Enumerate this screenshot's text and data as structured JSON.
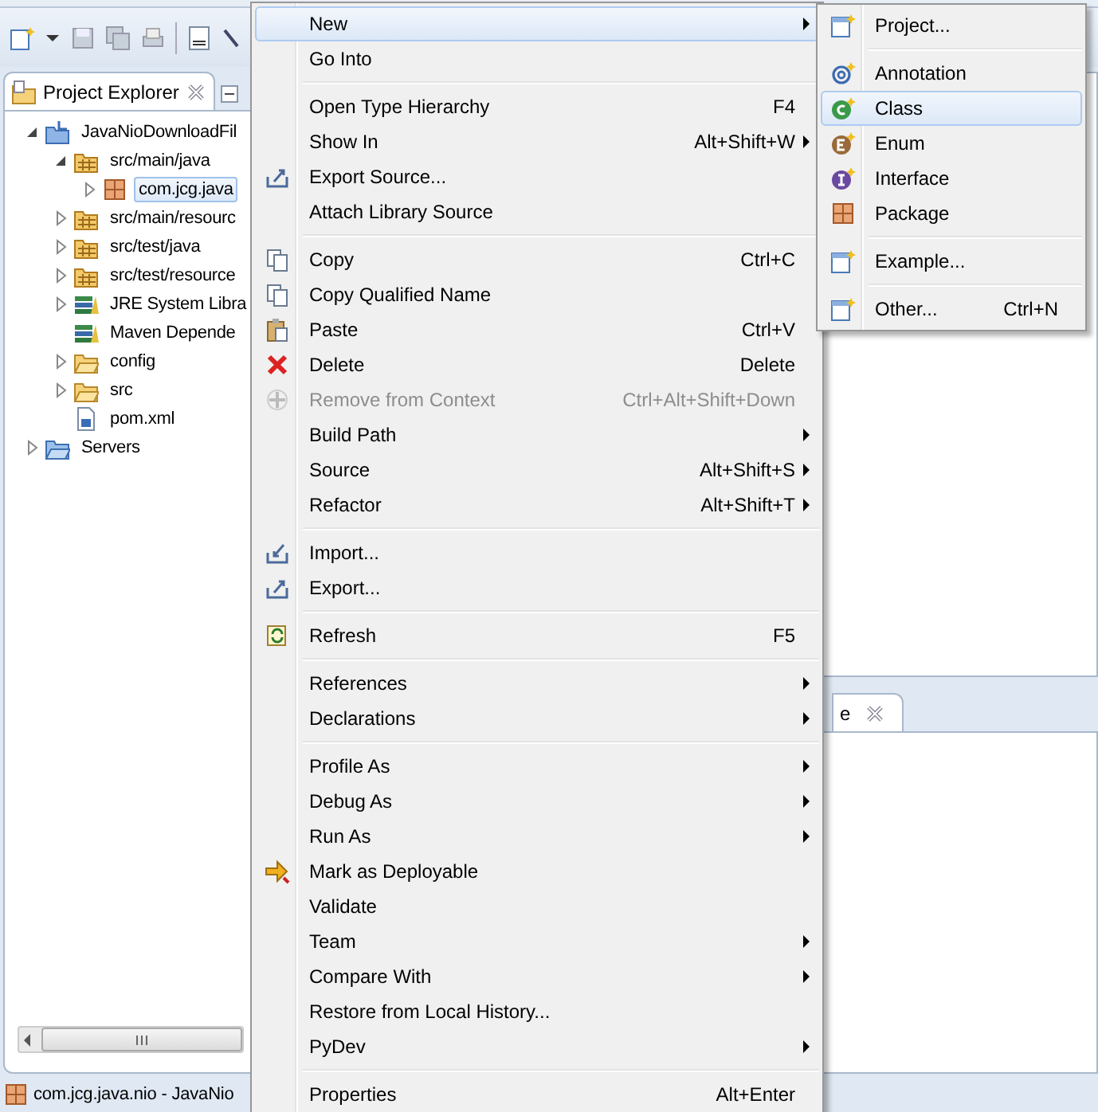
{
  "explorer": {
    "tab_title": "Project Explorer",
    "tree": [
      {
        "label": "JavaNioDownloadFil",
        "kind": "project",
        "expanded": true,
        "selected": false,
        "children": [
          {
            "label": "src/main/java",
            "kind": "source-folder",
            "expanded": true,
            "selected": false,
            "children": [
              {
                "label": "com.jcg.java",
                "kind": "package",
                "expanded": false,
                "selected": true
              }
            ]
          },
          {
            "label": "src/main/resourc",
            "kind": "source-folder",
            "expanded": false,
            "selected": false
          },
          {
            "label": "src/test/java",
            "kind": "source-folder",
            "expanded": false,
            "selected": false
          },
          {
            "label": "src/test/resource",
            "kind": "source-folder",
            "expanded": false,
            "selected": false
          },
          {
            "label": "JRE System Libra",
            "kind": "library",
            "expanded": false,
            "selected": false
          },
          {
            "label": "Maven Depende",
            "kind": "library",
            "selected": false
          },
          {
            "label": "config",
            "kind": "folder",
            "expanded": false,
            "selected": false
          },
          {
            "label": "src",
            "kind": "folder",
            "expanded": false,
            "selected": false
          },
          {
            "label": "pom.xml",
            "kind": "file",
            "selected": false
          }
        ]
      },
      {
        "label": "Servers",
        "kind": "server-folder",
        "expanded": false,
        "selected": false
      }
    ]
  },
  "lower_panel": {
    "tab_title": "e"
  },
  "status_bar": {
    "text": "com.jcg.java.nio - JavaNio"
  },
  "context_menu": {
    "items": [
      {
        "kind": "plain",
        "label": "New",
        "submenu": true,
        "selected": true,
        "disabled": false
      },
      {
        "kind": "plain",
        "label": "Go Into",
        "submenu": false,
        "selected": false,
        "disabled": false
      },
      {
        "kind": "separator"
      },
      {
        "kind": "plain",
        "label": "Open Type Hierarchy",
        "shortcut": "F4",
        "submenu": false,
        "selected": false,
        "disabled": false
      },
      {
        "kind": "plain",
        "label": "Show In",
        "shortcut": "Alt+Shift+W",
        "submenu": true,
        "selected": false,
        "disabled": false
      },
      {
        "kind": "export",
        "label": "Export Source...",
        "submenu": false,
        "selected": false,
        "disabled": false
      },
      {
        "kind": "plain",
        "label": "Attach Library Source",
        "submenu": false,
        "selected": false,
        "disabled": false
      },
      {
        "kind": "separator"
      },
      {
        "kind": "copy",
        "label": "Copy",
        "shortcut": "Ctrl+C",
        "submenu": false,
        "selected": false,
        "disabled": false
      },
      {
        "kind": "copy",
        "label": "Copy Qualified Name",
        "submenu": false,
        "selected": false,
        "disabled": false
      },
      {
        "kind": "paste",
        "label": "Paste",
        "shortcut": "Ctrl+V",
        "submenu": false,
        "selected": false,
        "disabled": false
      },
      {
        "kind": "delete",
        "label": "Delete",
        "shortcut": "Delete",
        "submenu": false,
        "selected": false,
        "disabled": false
      },
      {
        "kind": "remove",
        "label": "Remove from Context",
        "shortcut": "Ctrl+Alt+Shift+Down",
        "submenu": false,
        "selected": false,
        "disabled": true
      },
      {
        "kind": "plain",
        "label": "Build Path",
        "submenu": true,
        "selected": false,
        "disabled": false
      },
      {
        "kind": "plain",
        "label": "Source",
        "shortcut": "Alt+Shift+S",
        "submenu": true,
        "selected": false,
        "disabled": false
      },
      {
        "kind": "plain",
        "label": "Refactor",
        "shortcut": "Alt+Shift+T",
        "submenu": true,
        "selected": false,
        "disabled": false
      },
      {
        "kind": "separator"
      },
      {
        "kind": "import",
        "label": "Import...",
        "submenu": false,
        "selected": false,
        "disabled": false
      },
      {
        "kind": "export",
        "label": "Export...",
        "submenu": false,
        "selected": false,
        "disabled": false
      },
      {
        "kind": "separator"
      },
      {
        "kind": "refresh",
        "label": "Refresh",
        "shortcut": "F5",
        "submenu": false,
        "selected": false,
        "disabled": false
      },
      {
        "kind": "separator"
      },
      {
        "kind": "plain",
        "label": "References",
        "submenu": true,
        "selected": false,
        "disabled": false
      },
      {
        "kind": "plain",
        "label": "Declarations",
        "submenu": true,
        "selected": false,
        "disabled": false
      },
      {
        "kind": "separator"
      },
      {
        "kind": "plain",
        "label": "Profile As",
        "submenu": true,
        "selected": false,
        "disabled": false
      },
      {
        "kind": "plain",
        "label": "Debug As",
        "submenu": true,
        "selected": false,
        "disabled": false
      },
      {
        "kind": "plain",
        "label": "Run As",
        "submenu": true,
        "selected": false,
        "disabled": false
      },
      {
        "kind": "deploy",
        "label": "Mark as Deployable",
        "submenu": false,
        "selected": false,
        "disabled": false
      },
      {
        "kind": "plain",
        "label": "Validate",
        "submenu": false,
        "selected": false,
        "disabled": false
      },
      {
        "kind": "plain",
        "label": "Team",
        "submenu": true,
        "selected": false,
        "disabled": false
      },
      {
        "kind": "plain",
        "label": "Compare With",
        "submenu": true,
        "selected": false,
        "disabled": false
      },
      {
        "kind": "plain",
        "label": "Restore from Local History...",
        "submenu": false,
        "selected": false,
        "disabled": false
      },
      {
        "kind": "plain",
        "label": "PyDev",
        "submenu": true,
        "selected": false,
        "disabled": false
      },
      {
        "kind": "separator"
      },
      {
        "kind": "plain",
        "label": "Properties",
        "shortcut": "Alt+Enter",
        "submenu": false,
        "selected": false,
        "disabled": false
      }
    ]
  },
  "new_submenu": {
    "items": [
      {
        "kind": "wizard",
        "label": "Project...",
        "submenu": false,
        "selected": false,
        "disabled": false
      },
      {
        "kind": "separator"
      },
      {
        "kind": "annotation",
        "label": "Annotation",
        "submenu": false,
        "selected": false,
        "disabled": false
      },
      {
        "kind": "class",
        "label": "Class",
        "submenu": false,
        "selected": true,
        "disabled": false
      },
      {
        "kind": "enum",
        "label": "Enum",
        "submenu": false,
        "selected": false,
        "disabled": false
      },
      {
        "kind": "interface",
        "label": "Interface",
        "submenu": false,
        "selected": false,
        "disabled": false
      },
      {
        "kind": "package",
        "label": "Package",
        "submenu": false,
        "selected": false,
        "disabled": false
      },
      {
        "kind": "separator"
      },
      {
        "kind": "wizard",
        "label": "Example...",
        "submenu": false,
        "selected": false,
        "disabled": false
      },
      {
        "kind": "separator"
      },
      {
        "kind": "wizard",
        "label": "Other...",
        "shortcut": "Ctrl+N",
        "submenu": false,
        "selected": false,
        "disabled": false
      }
    ]
  }
}
